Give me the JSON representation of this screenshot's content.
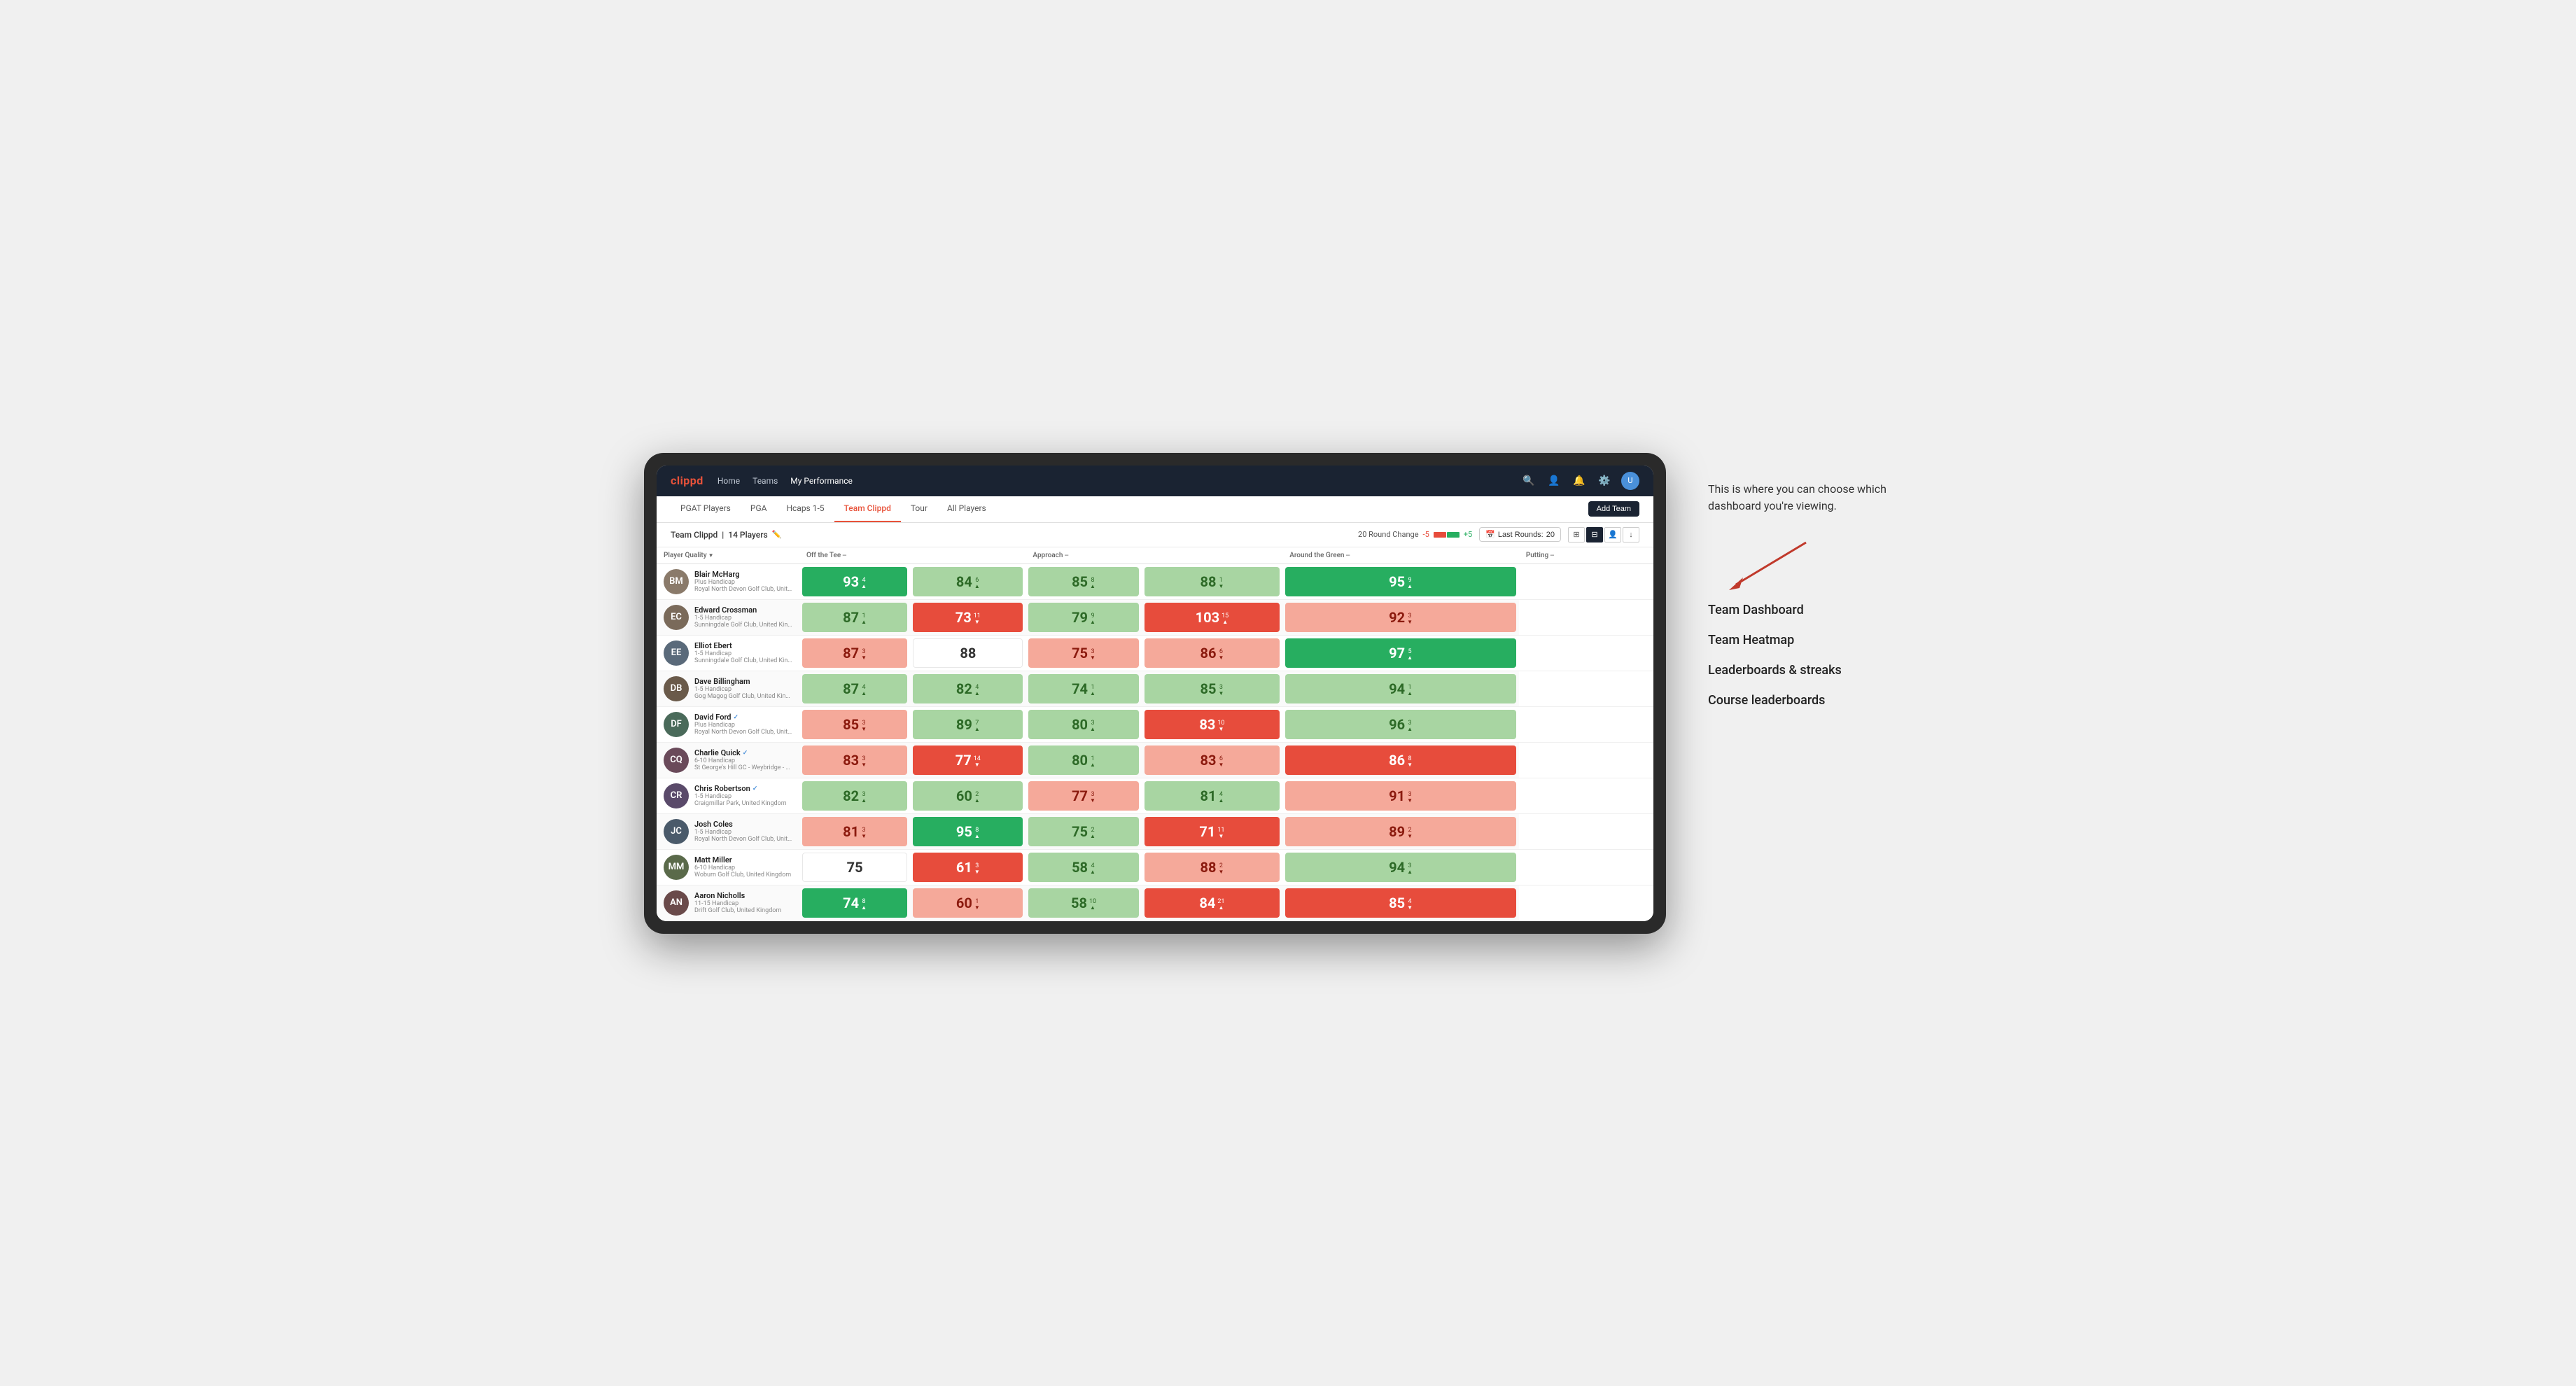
{
  "app": {
    "logo": "clippd",
    "nav": {
      "links": [
        "Home",
        "Teams",
        "My Performance"
      ],
      "active": "My Performance",
      "icons": [
        "search",
        "person",
        "bell",
        "settings",
        "avatar"
      ]
    }
  },
  "tabs": {
    "items": [
      "PGAT Players",
      "PGA",
      "Hcaps 1-5",
      "Team Clippd",
      "Tour",
      "All Players"
    ],
    "active": "Team Clippd",
    "add_button": "Add Team"
  },
  "subheader": {
    "team_title": "Team Clippd",
    "player_count": "14 Players",
    "round_change_label": "20 Round Change",
    "negative": "-5",
    "positive": "+5",
    "last_rounds_label": "Last Rounds:",
    "last_rounds_value": "20"
  },
  "table": {
    "headers": {
      "player_quality": "Player Quality",
      "off_tee": "Off the Tee",
      "approach": "Approach",
      "around_green": "Around the Green",
      "putting": "Putting"
    },
    "players": [
      {
        "name": "Blair McHarg",
        "handicap": "Plus Handicap",
        "club": "Royal North Devon Golf Club, United Kingdom",
        "initials": "BM",
        "avatar_color": "#8a7a6a",
        "scores": {
          "player_quality": {
            "value": 93,
            "change": 4,
            "trend": "up",
            "color": "dark-green"
          },
          "off_tee": {
            "value": 84,
            "change": 6,
            "trend": "up",
            "color": "light-green"
          },
          "approach": {
            "value": 85,
            "change": 8,
            "trend": "up",
            "color": "light-green"
          },
          "around_green": {
            "value": 88,
            "change": 1,
            "trend": "down",
            "color": "light-green"
          },
          "putting": {
            "value": 95,
            "change": 9,
            "trend": "up",
            "color": "dark-green"
          }
        }
      },
      {
        "name": "Edward Crossman",
        "handicap": "1-5 Handicap",
        "club": "Sunningdale Golf Club, United Kingdom",
        "initials": "EC",
        "avatar_color": "#7a6a5a",
        "scores": {
          "player_quality": {
            "value": 87,
            "change": 1,
            "trend": "up",
            "color": "light-green"
          },
          "off_tee": {
            "value": 73,
            "change": 11,
            "trend": "down",
            "color": "dark-red"
          },
          "approach": {
            "value": 79,
            "change": 9,
            "trend": "up",
            "color": "light-green"
          },
          "around_green": {
            "value": 103,
            "change": 15,
            "trend": "up",
            "color": "dark-red"
          },
          "putting": {
            "value": 92,
            "change": 3,
            "trend": "down",
            "color": "light-red"
          }
        }
      },
      {
        "name": "Elliot Ebert",
        "handicap": "1-5 Handicap",
        "club": "Sunningdale Golf Club, United Kingdom",
        "initials": "EE",
        "avatar_color": "#5a6a7a",
        "scores": {
          "player_quality": {
            "value": 87,
            "change": 3,
            "trend": "down",
            "color": "light-red"
          },
          "off_tee": {
            "value": 88,
            "change": null,
            "trend": null,
            "color": "white"
          },
          "approach": {
            "value": 75,
            "change": 3,
            "trend": "down",
            "color": "light-red"
          },
          "around_green": {
            "value": 86,
            "change": 6,
            "trend": "down",
            "color": "light-red"
          },
          "putting": {
            "value": 97,
            "change": 5,
            "trend": "up",
            "color": "dark-green"
          }
        }
      },
      {
        "name": "Dave Billingham",
        "handicap": "1-5 Handicap",
        "club": "Gog Magog Golf Club, United Kingdom",
        "initials": "DB",
        "avatar_color": "#6a5a4a",
        "scores": {
          "player_quality": {
            "value": 87,
            "change": 4,
            "trend": "up",
            "color": "light-green"
          },
          "off_tee": {
            "value": 82,
            "change": 4,
            "trend": "up",
            "color": "light-green"
          },
          "approach": {
            "value": 74,
            "change": 1,
            "trend": "up",
            "color": "light-green"
          },
          "around_green": {
            "value": 85,
            "change": 3,
            "trend": "down",
            "color": "light-green"
          },
          "putting": {
            "value": 94,
            "change": 1,
            "trend": "up",
            "color": "light-green"
          }
        }
      },
      {
        "name": "David Ford",
        "handicap": "Plus Handicap",
        "club": "Royal North Devon Golf Club, United Kingdom",
        "initials": "DF",
        "verified": true,
        "avatar_color": "#4a6a5a",
        "scores": {
          "player_quality": {
            "value": 85,
            "change": 3,
            "trend": "down",
            "color": "light-red"
          },
          "off_tee": {
            "value": 89,
            "change": 7,
            "trend": "up",
            "color": "light-green"
          },
          "approach": {
            "value": 80,
            "change": 3,
            "trend": "up",
            "color": "light-green"
          },
          "around_green": {
            "value": 83,
            "change": 10,
            "trend": "down",
            "color": "dark-red"
          },
          "putting": {
            "value": 96,
            "change": 3,
            "trend": "up",
            "color": "light-green"
          }
        }
      },
      {
        "name": "Charlie Quick",
        "handicap": "6-10 Handicap",
        "club": "St George's Hill GC - Weybridge - Surrey, Uni...",
        "initials": "CQ",
        "verified": true,
        "avatar_color": "#6a4a5a",
        "scores": {
          "player_quality": {
            "value": 83,
            "change": 3,
            "trend": "down",
            "color": "light-red"
          },
          "off_tee": {
            "value": 77,
            "change": 14,
            "trend": "down",
            "color": "dark-red"
          },
          "approach": {
            "value": 80,
            "change": 1,
            "trend": "up",
            "color": "light-green"
          },
          "around_green": {
            "value": 83,
            "change": 6,
            "trend": "down",
            "color": "light-red"
          },
          "putting": {
            "value": 86,
            "change": 8,
            "trend": "down",
            "color": "dark-red"
          }
        }
      },
      {
        "name": "Chris Robertson",
        "handicap": "1-5 Handicap",
        "club": "Craigmillar Park, United Kingdom",
        "initials": "CR",
        "verified": true,
        "avatar_color": "#5a4a6a",
        "scores": {
          "player_quality": {
            "value": 82,
            "change": 3,
            "trend": "up",
            "color": "light-green"
          },
          "off_tee": {
            "value": 60,
            "change": 2,
            "trend": "up",
            "color": "light-green"
          },
          "approach": {
            "value": 77,
            "change": 3,
            "trend": "down",
            "color": "light-red"
          },
          "around_green": {
            "value": 81,
            "change": 4,
            "trend": "up",
            "color": "light-green"
          },
          "putting": {
            "value": 91,
            "change": 3,
            "trend": "down",
            "color": "light-red"
          }
        }
      },
      {
        "name": "Josh Coles",
        "handicap": "1-5 Handicap",
        "club": "Royal North Devon Golf Club, United Kingdom",
        "initials": "JC",
        "avatar_color": "#4a5a6a",
        "scores": {
          "player_quality": {
            "value": 81,
            "change": 3,
            "trend": "down",
            "color": "light-red"
          },
          "off_tee": {
            "value": 95,
            "change": 8,
            "trend": "up",
            "color": "dark-green"
          },
          "approach": {
            "value": 75,
            "change": 2,
            "trend": "up",
            "color": "light-green"
          },
          "around_green": {
            "value": 71,
            "change": 11,
            "trend": "down",
            "color": "dark-red"
          },
          "putting": {
            "value": 89,
            "change": 2,
            "trend": "down",
            "color": "light-red"
          }
        }
      },
      {
        "name": "Matt Miller",
        "handicap": "6-10 Handicap",
        "club": "Woburn Golf Club, United Kingdom",
        "initials": "MM",
        "avatar_color": "#5a6a4a",
        "scores": {
          "player_quality": {
            "value": 75,
            "change": null,
            "trend": null,
            "color": "white"
          },
          "off_tee": {
            "value": 61,
            "change": 3,
            "trend": "down",
            "color": "dark-red"
          },
          "approach": {
            "value": 58,
            "change": 4,
            "trend": "up",
            "color": "light-green"
          },
          "around_green": {
            "value": 88,
            "change": 2,
            "trend": "down",
            "color": "light-red"
          },
          "putting": {
            "value": 94,
            "change": 3,
            "trend": "up",
            "color": "light-green"
          }
        }
      },
      {
        "name": "Aaron Nicholls",
        "handicap": "11-15 Handicap",
        "club": "Drift Golf Club, United Kingdom",
        "initials": "AN",
        "avatar_color": "#6a4a4a",
        "scores": {
          "player_quality": {
            "value": 74,
            "change": 8,
            "trend": "up",
            "color": "dark-green"
          },
          "off_tee": {
            "value": 60,
            "change": 1,
            "trend": "down",
            "color": "light-red"
          },
          "approach": {
            "value": 58,
            "change": 10,
            "trend": "up",
            "color": "light-green"
          },
          "around_green": {
            "value": 84,
            "change": 21,
            "trend": "up",
            "color": "dark-red"
          },
          "putting": {
            "value": 85,
            "change": 4,
            "trend": "down",
            "color": "dark-red"
          }
        }
      }
    ]
  },
  "annotation": {
    "intro": "This is where you can choose which dashboard you're viewing.",
    "items": [
      "Team Dashboard",
      "Team Heatmap",
      "Leaderboards & streaks",
      "Course leaderboards"
    ]
  }
}
